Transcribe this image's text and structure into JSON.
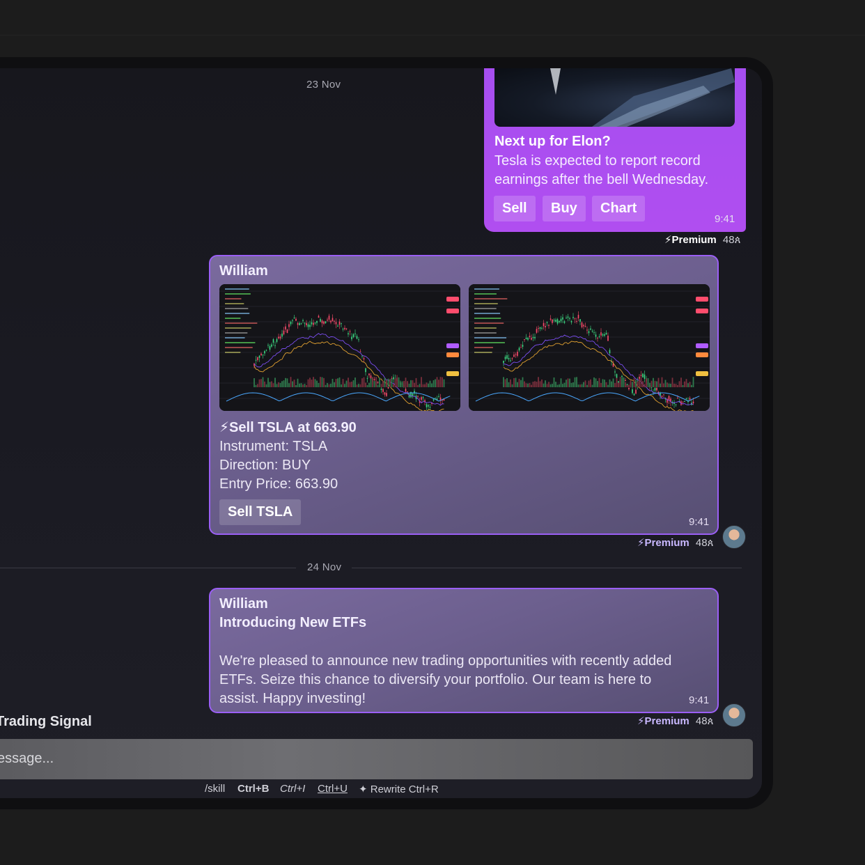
{
  "dates": {
    "first": "23 Nov",
    "second": "24 Nov"
  },
  "news_card": {
    "title": "Next up for Elon?",
    "text_line1": "Tesla is expected to report record",
    "text_line2": "earnings after the bell Wednesday.",
    "buttons": [
      "Sell",
      "Buy",
      "Chart"
    ],
    "time": "9:41",
    "premium_label": "Premium",
    "count": "48"
  },
  "signal_message": {
    "sender": "William",
    "headline": "⚡Sell TSLA at 663.90",
    "line1": "Instrument: TSLA",
    "line2": "Direction: BUY",
    "line3": "Entry Price: 663.90",
    "button": "Sell TSLA",
    "time": "9:41",
    "premium_label": "Premium",
    "count": "48"
  },
  "etf_message": {
    "sender": "William",
    "title": "Introducing New ETFs",
    "line1": "We're pleased to announce new trading opportunities with recently added",
    "line2": "ETFs. Seize this chance to diversify your portfolio. Our team is here to",
    "line3": "assist. Happy investing!",
    "time": "9:41",
    "premium_label": "Premium",
    "count": "48"
  },
  "sidebar_partial": {
    "label": "Trading Signal"
  },
  "composer": {
    "placeholder": "essage...",
    "shortcuts": {
      "skill": "/skill",
      "bold": "Ctrl+B",
      "italic": "Ctrl+I",
      "underline": "Ctrl+U",
      "rewrite": "Rewrite Ctrl+R"
    }
  },
  "colors": {
    "accent_purple": "#a54ef0",
    "bubble_border": "#9b5ff5",
    "premium": "#c9b8ff"
  },
  "icons": [
    "bolt-icon",
    "person-icon",
    "sparkle-icon",
    "avatar"
  ]
}
